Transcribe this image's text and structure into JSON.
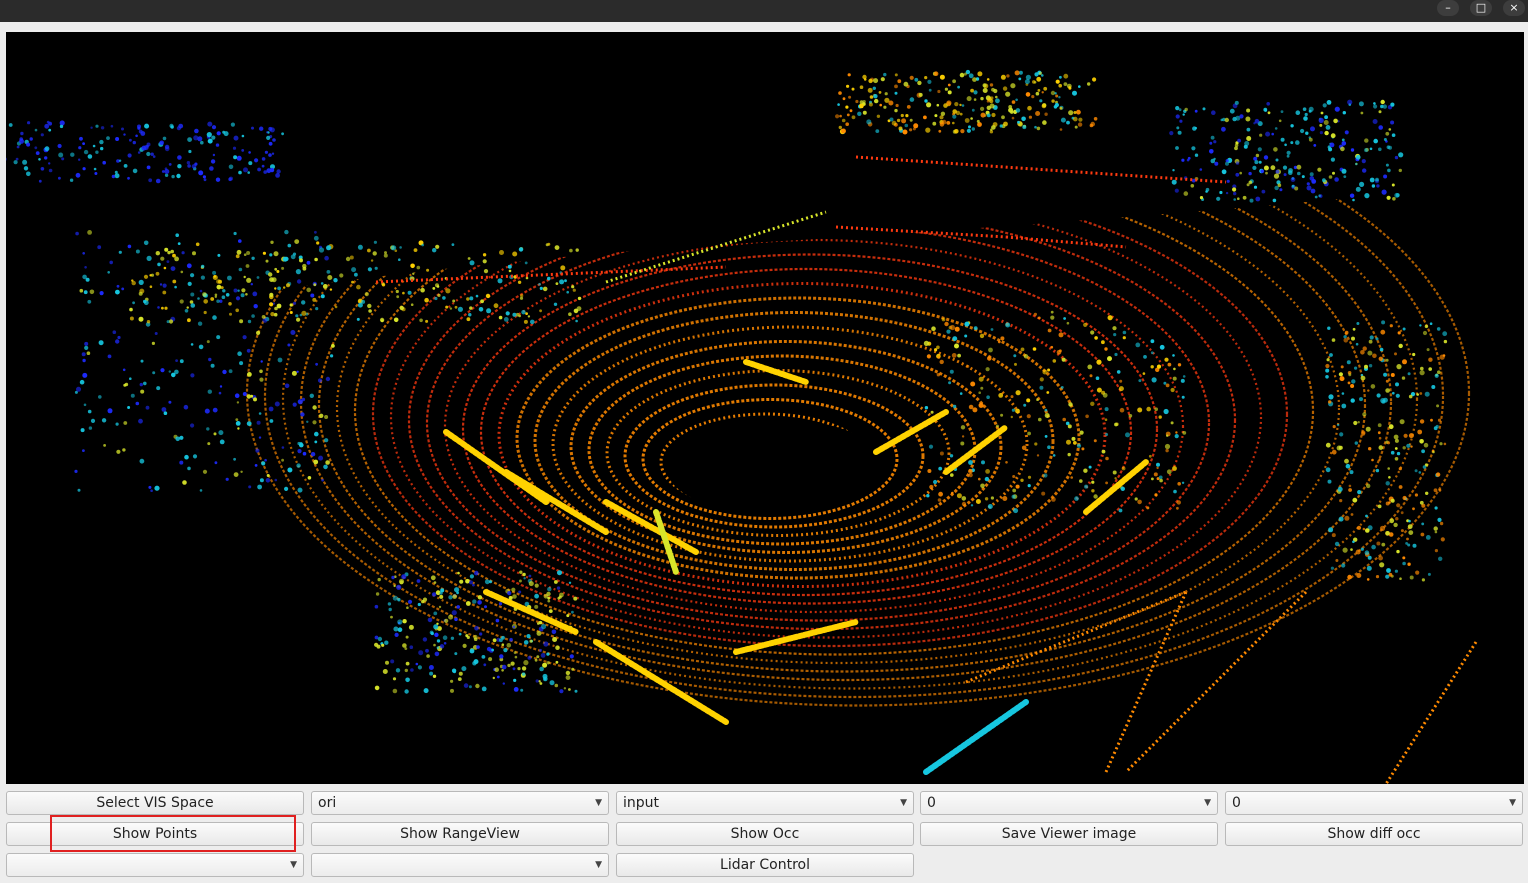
{
  "window": {
    "controls": {
      "minimize_glyph": "–",
      "maximize_glyph": "□",
      "close_glyph": "×"
    }
  },
  "viewer": {
    "background": "#000000",
    "colormap": [
      "#1d2bff",
      "#16c7e0",
      "#d9e62a",
      "#ffd200",
      "#ff8a00",
      "#ff3a10"
    ]
  },
  "controls": {
    "row1": {
      "select_vis_space_label": "Select VIS Space",
      "combo_mode_value": "ori",
      "combo_source_value": "input",
      "combo_index_a_value": "0",
      "combo_index_b_value": "0"
    },
    "row2": {
      "show_points_label": "Show Points",
      "show_rangeview_label": "Show RangeView",
      "show_occ_label": "Show Occ",
      "save_viewer_image_label": "Save Viewer image",
      "show_diff_occ_label": "Show diff occ"
    },
    "row3": {
      "combo_empty_a_value": "",
      "combo_empty_b_value": "",
      "lidar_control_label": "Lidar Control"
    }
  },
  "annotation": {
    "highlight_color": "#e02020",
    "highlight_target": "show-points-button"
  }
}
